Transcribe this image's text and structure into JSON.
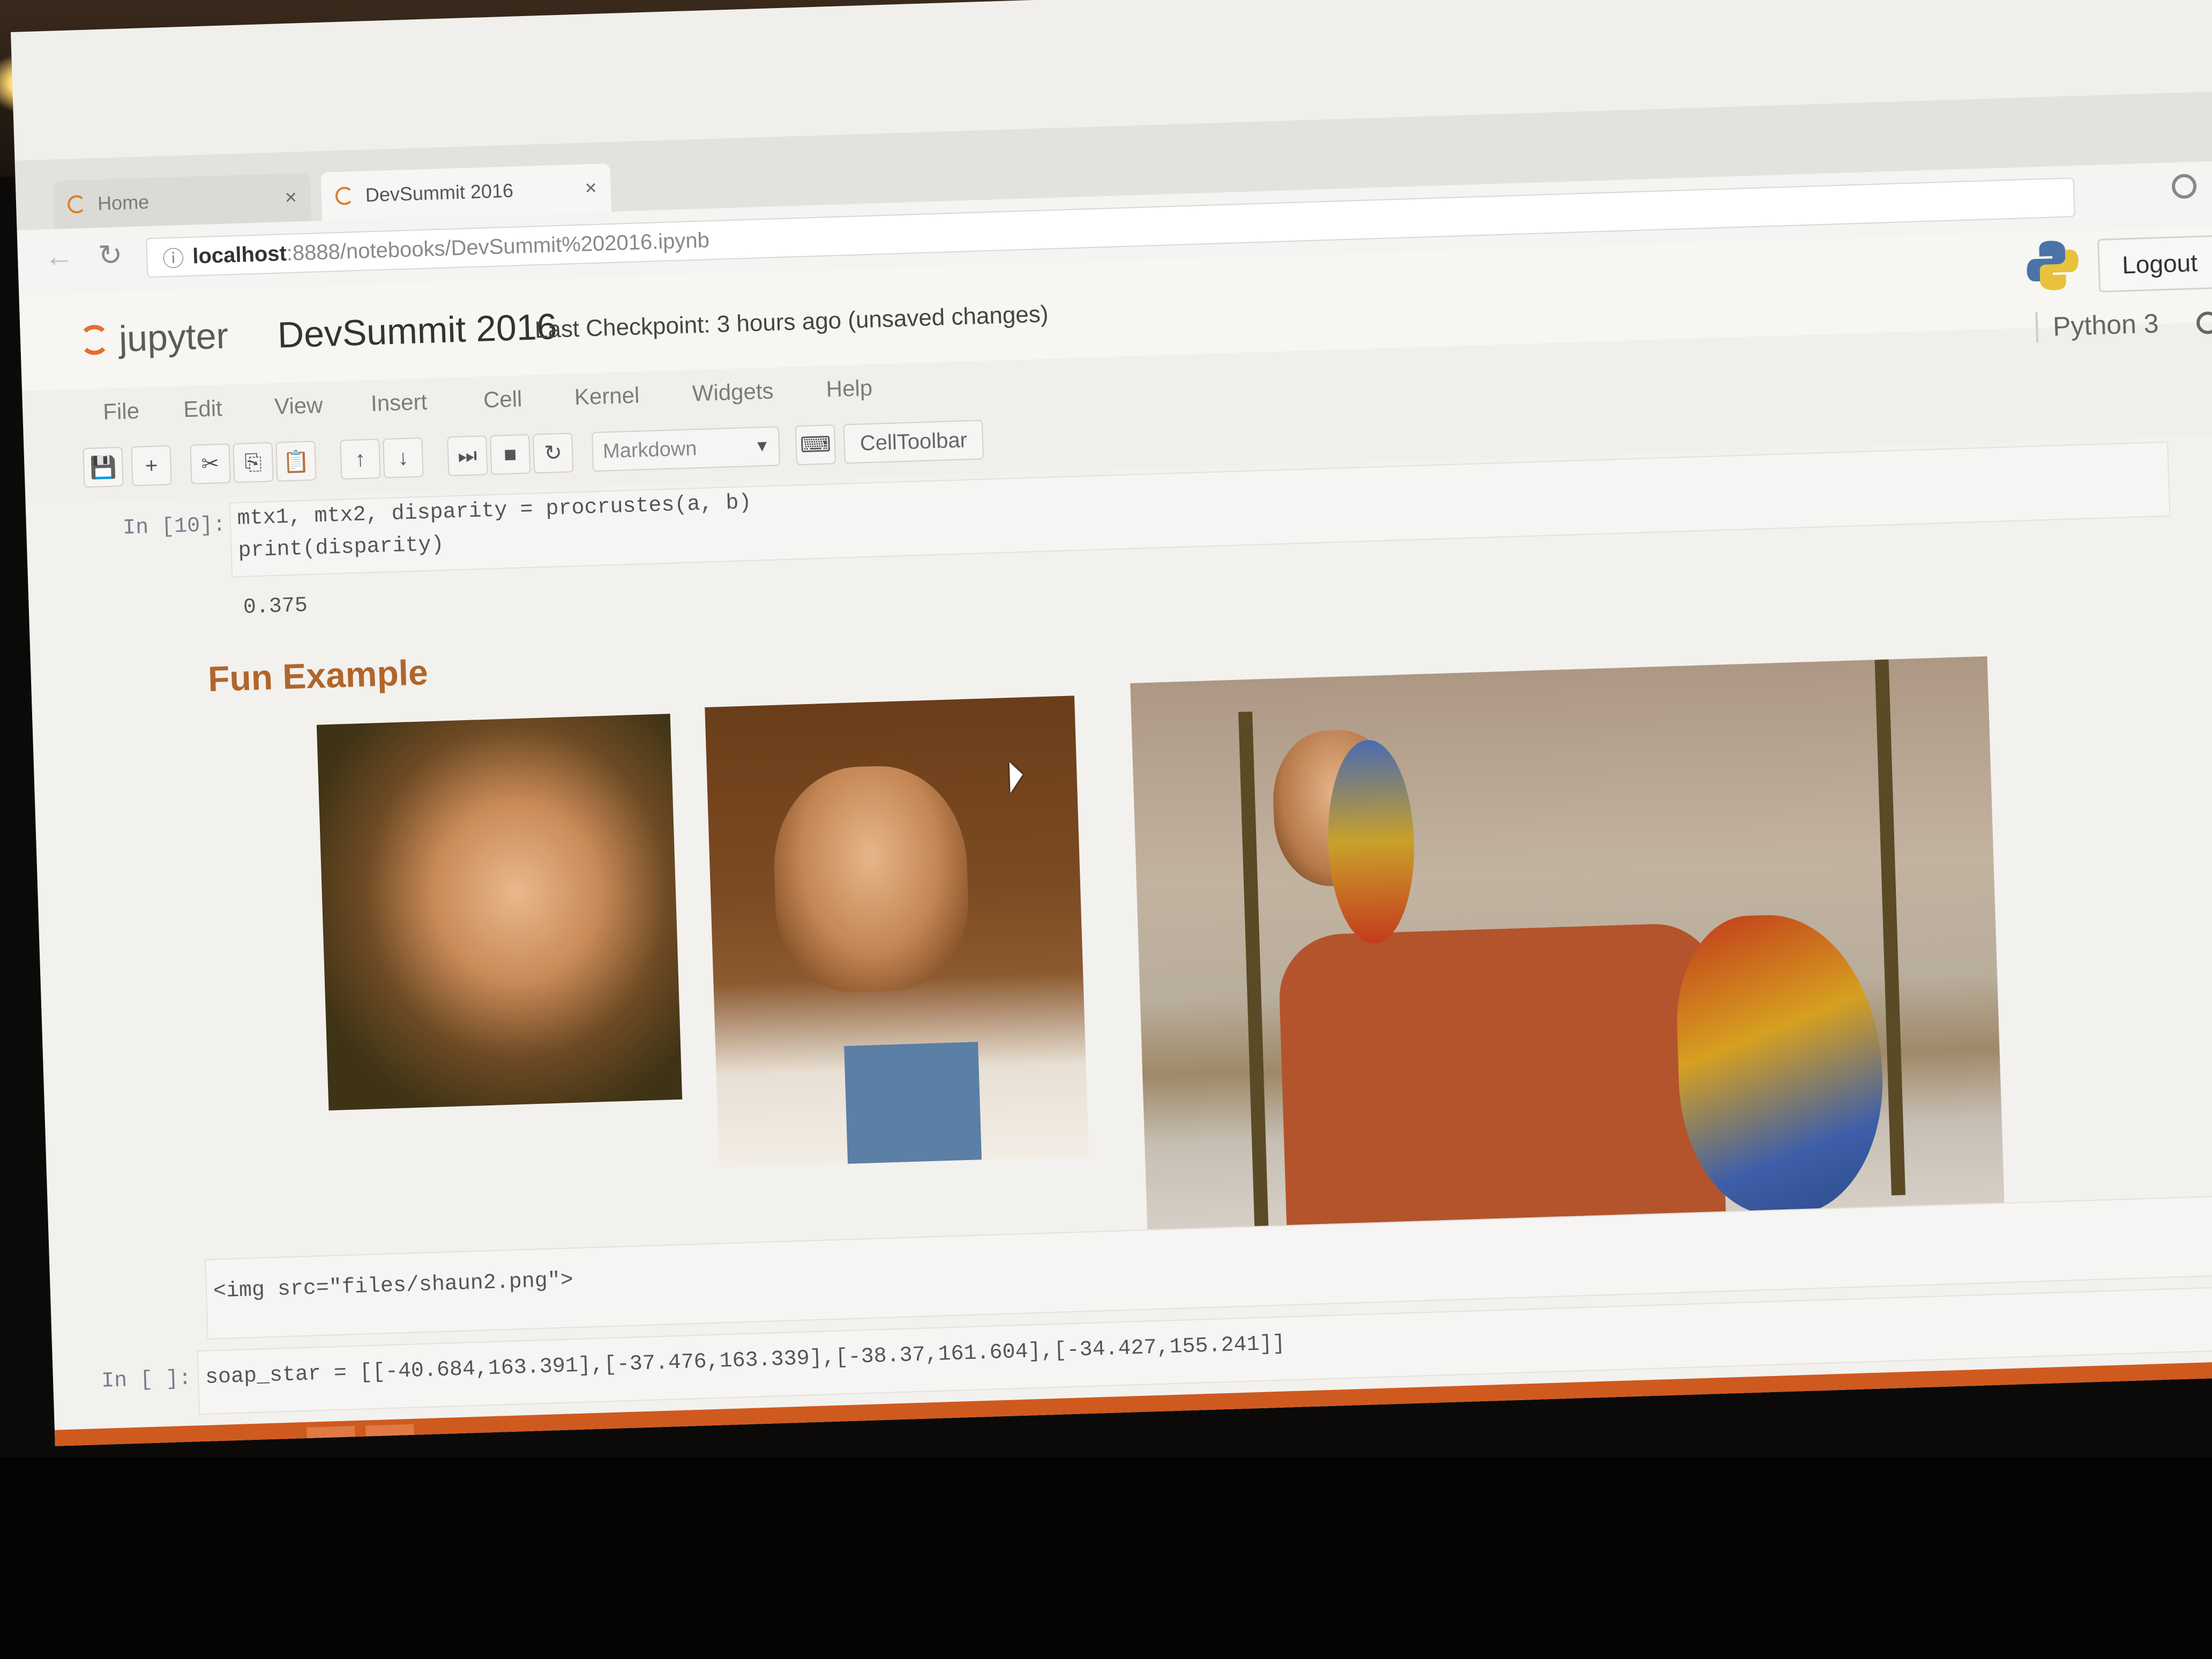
{
  "browser": {
    "tabs": [
      {
        "label": "Home"
      },
      {
        "label": "DevSummit 2016"
      }
    ],
    "tab_close": "×",
    "url": {
      "host": "localhost",
      "path": ":8888/notebooks/DevSummit%202016.ipynb"
    }
  },
  "jupyter": {
    "logo_text": "jupyter",
    "notebook_name": "DevSummit 2016",
    "checkpoint": "Last Checkpoint: 3 hours ago (unsaved changes)",
    "logout_label": "Logout",
    "kernel_name": "Python 3"
  },
  "menu": [
    "File",
    "Edit",
    "View",
    "Insert",
    "Cell",
    "Kernel",
    "Widgets",
    "Help"
  ],
  "toolbar": {
    "cell_type": "Markdown",
    "celltoolbar_label": "CellToolbar"
  },
  "cells": {
    "cell1": {
      "prompt": "In [10]:",
      "line1": "mtx1, mtx2, disparity = procrustes(a, b)",
      "line2": "print(disparity)",
      "output": "0.375"
    },
    "markdown_title": "Fun Example",
    "markdown_source": "<img src=\"files/shaun2.png\">",
    "cell3": {
      "prompt": "In [ ]:",
      "line1": "soap_star = [[-40.684,163.391],[-37.476,163.339],[-38.37,161.604],[-34.427,155.241]]"
    }
  },
  "icons": {
    "reload": "↻",
    "new_tab": "+",
    "save": "💾",
    "insert": "+",
    "cut": "✂",
    "copy": "⎘",
    "paste": "📋",
    "up": "↑",
    "down": "↓",
    "run": "⏭",
    "stop": "■",
    "restart": "↻",
    "keyboard": "⌨"
  },
  "colors": {
    "accent": "#e46e2e",
    "title": "#b0662c",
    "taskbar": "#cf5a1f"
  }
}
